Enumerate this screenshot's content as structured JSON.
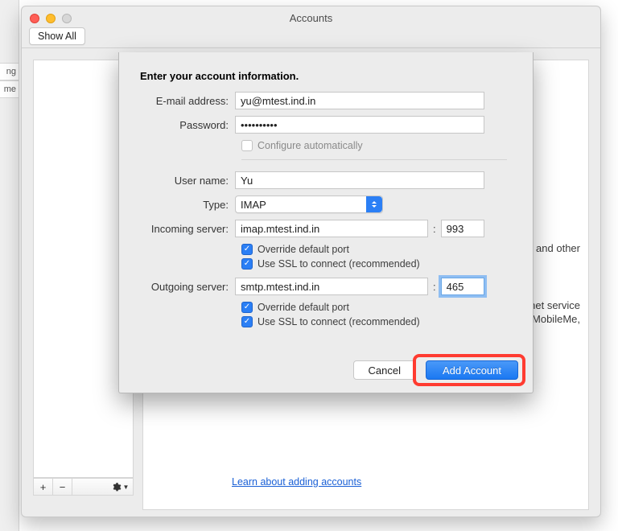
{
  "window": {
    "title": "Accounts",
    "show_all_label": "Show All"
  },
  "bg_sidebar": {
    "row1": "ng",
    "row2": "me"
  },
  "panel_bg": {
    "line1a": "tions and other",
    "line2a": "iternet service",
    "line2b": "nail, MobileMe,",
    "learn_link": "Learn about adding accounts"
  },
  "list_footer": {
    "add": "+",
    "remove": "−"
  },
  "dialog": {
    "title": "Enter your account information.",
    "labels": {
      "email": "E-mail address:",
      "password": "Password:",
      "configure_auto": "Configure automatically",
      "username": "User name:",
      "type": "Type:",
      "incoming": "Incoming server:",
      "outgoing": "Outgoing server:",
      "override_port": "Override default port",
      "use_ssl": "Use SSL to connect (recommended)"
    },
    "values": {
      "email": "yu@mtest.ind.in",
      "password": "••••••••••",
      "username": "Yu",
      "type": "IMAP",
      "incoming_server": "imap.mtest.ind.in",
      "incoming_port": "993",
      "outgoing_server": "smtp.mtest.ind.in",
      "outgoing_port": "465"
    },
    "buttons": {
      "cancel": "Cancel",
      "add": "Add Account"
    }
  }
}
